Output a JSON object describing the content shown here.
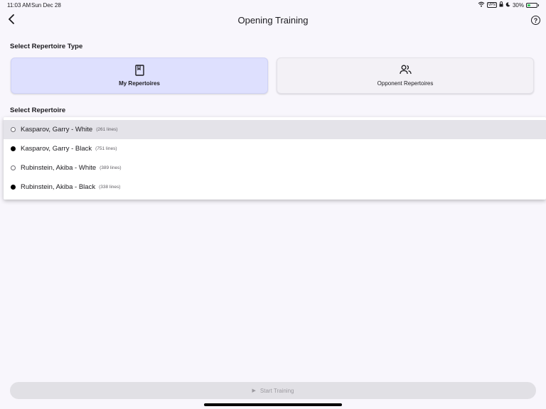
{
  "status_bar": {
    "time": "11:03 AM",
    "date": "Sun Dec 28",
    "vpn": "VPN",
    "battery": "30%",
    "battery_level": 0.3
  },
  "header": {
    "title": "Opening Training",
    "back_icon": "chevron-left-icon",
    "help_icon": "question-circle-icon",
    "help_glyph": "?"
  },
  "repertoire_type": {
    "section_label": "Select Repertoire Type",
    "options": [
      {
        "label": "My Repertoires",
        "icon": "book-icon",
        "selected": true
      },
      {
        "label": "Opponent Repertoires",
        "icon": "people-icon",
        "selected": false
      }
    ]
  },
  "repertoire": {
    "section_label": "Select Repertoire",
    "items": [
      {
        "name": "Kasparov, Garry - White",
        "count": "(261 lines)",
        "color": "white",
        "highlighted": true
      },
      {
        "name": "Kasparov, Garry - Black",
        "count": "(751 lines)",
        "color": "black",
        "highlighted": false
      },
      {
        "name": "Rubinstein, Akiba - White",
        "count": "(389 lines)",
        "color": "white",
        "highlighted": false
      },
      {
        "name": "Rubinstein, Akiba - Black",
        "count": "(338 lines)",
        "color": "black",
        "highlighted": false
      }
    ]
  },
  "footer": {
    "start_label": "Start Training",
    "play_glyph": "▶",
    "enabled": false
  }
}
